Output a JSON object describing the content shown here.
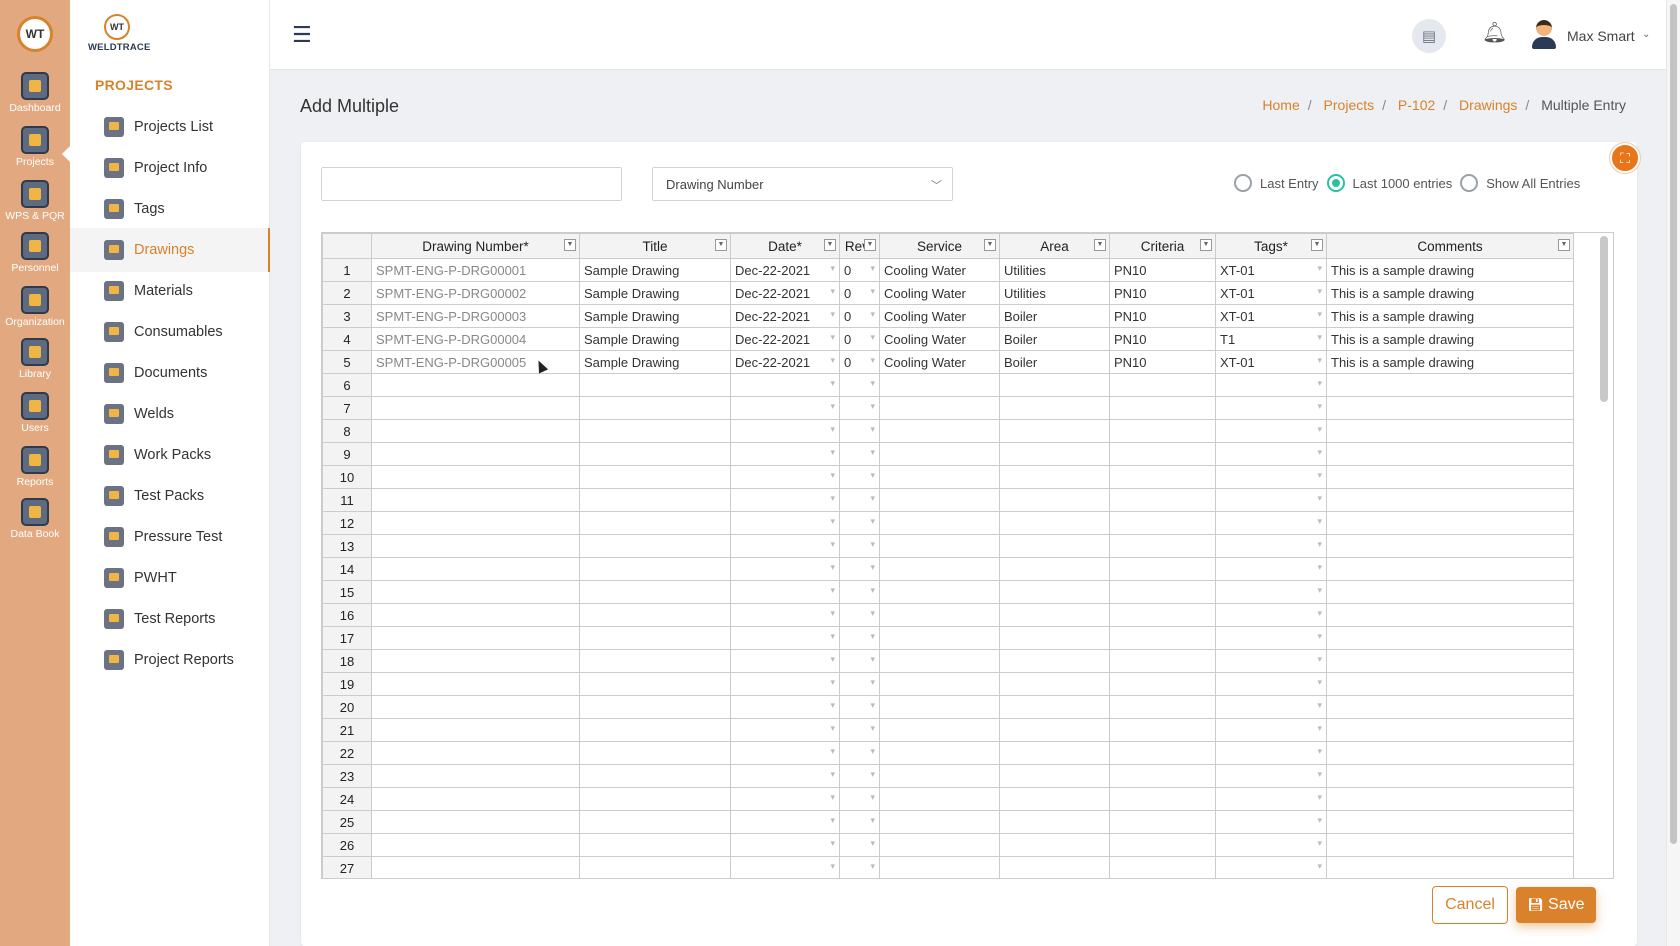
{
  "rail": {
    "logo_text": "WT",
    "items": [
      {
        "label": "Dashboard",
        "icon": "dashboard-icon"
      },
      {
        "label": "Projects",
        "icon": "projects-icon"
      },
      {
        "label": "WPS & PQR",
        "icon": "wps-pqr-icon"
      },
      {
        "label": "Personnel",
        "icon": "personnel-icon"
      },
      {
        "label": "Organization",
        "icon": "organization-icon"
      },
      {
        "label": "Library",
        "icon": "library-icon"
      },
      {
        "label": "Users",
        "icon": "users-icon"
      },
      {
        "label": "Reports",
        "icon": "reports-icon"
      },
      {
        "label": "Data Book",
        "icon": "data-book-icon"
      }
    ]
  },
  "brand": {
    "mark": "WT",
    "name": "WELDTRACE"
  },
  "subnav": {
    "heading": "PROJECTS",
    "items": [
      {
        "label": "Projects List",
        "icon": "projects-list-icon",
        "active": false
      },
      {
        "label": "Project Info",
        "icon": "project-info-icon",
        "active": false
      },
      {
        "label": "Tags",
        "icon": "tags-icon",
        "active": false
      },
      {
        "label": "Drawings",
        "icon": "drawings-icon",
        "active": true
      },
      {
        "label": "Materials",
        "icon": "materials-icon",
        "active": false
      },
      {
        "label": "Consumables",
        "icon": "consumables-icon",
        "active": false
      },
      {
        "label": "Documents",
        "icon": "documents-icon",
        "active": false
      },
      {
        "label": "Welds",
        "icon": "welds-icon",
        "active": false
      },
      {
        "label": "Work Packs",
        "icon": "work-packs-icon",
        "active": false
      },
      {
        "label": "Test Packs",
        "icon": "test-packs-icon",
        "active": false
      },
      {
        "label": "Pressure Test",
        "icon": "pressure-test-icon",
        "active": false
      },
      {
        "label": "PWHT",
        "icon": "pwht-icon",
        "active": false
      },
      {
        "label": "Test Reports",
        "icon": "test-reports-icon",
        "active": false
      },
      {
        "label": "Project Reports",
        "icon": "project-reports-icon",
        "active": false
      }
    ]
  },
  "topbar": {
    "user_name": "Max Smart"
  },
  "page": {
    "title": "Add Multiple",
    "breadcrumb": [
      "Home",
      "Projects",
      "P-102",
      "Drawings",
      "Multiple Entry"
    ]
  },
  "filters": {
    "search_value": "",
    "column_select": "Drawing Number",
    "radios": [
      {
        "label": "Last Entry",
        "checked": false
      },
      {
        "label": "Last 1000 entries",
        "checked": true
      },
      {
        "label": "Show All Entries",
        "checked": false
      }
    ]
  },
  "grid": {
    "columns": [
      "Drawing Number*",
      "Title",
      "Date*",
      "Rev*",
      "Service",
      "Area",
      "Criteria",
      "Tags*",
      "Comments"
    ],
    "rows": [
      [
        "SPMT-ENG-P-DRG00001",
        "Sample Drawing",
        "Dec-22-2021",
        "0",
        "Cooling Water",
        "Utilities",
        "PN10",
        "XT-01",
        "This is a sample drawing"
      ],
      [
        "SPMT-ENG-P-DRG00002",
        "Sample Drawing",
        "Dec-22-2021",
        "0",
        "Cooling Water",
        "Utilities",
        "PN10",
        "XT-01",
        "This is a sample drawing"
      ],
      [
        "SPMT-ENG-P-DRG00003",
        "Sample Drawing",
        "Dec-22-2021",
        "0",
        "Cooling Water",
        "Boiler",
        "PN10",
        "XT-01",
        "This is a sample drawing"
      ],
      [
        "SPMT-ENG-P-DRG00004",
        "Sample Drawing",
        "Dec-22-2021",
        "0",
        "Cooling Water",
        "Boiler",
        "PN10",
        "T1",
        "This is a sample drawing"
      ],
      [
        "SPMT-ENG-P-DRG00005",
        "Sample Drawing",
        "Dec-22-2021",
        "0",
        "Cooling Water",
        "Boiler",
        "PN10",
        "XT-01",
        "This is a sample drawing"
      ]
    ],
    "total_visible_rows": 27
  },
  "actions": {
    "cancel_label": "Cancel",
    "save_label": "Save"
  },
  "colors": {
    "accent": "#d9822b",
    "rail": "#e2a981",
    "radio_checked": "#2bbfa4"
  }
}
